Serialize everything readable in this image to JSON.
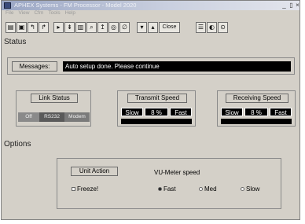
{
  "window": {
    "title": "APHEX Systems - FM Processor - Model 2020"
  },
  "menu": [
    "File",
    "View",
    "Cfm",
    "Tools",
    "Help"
  ],
  "toolbar": {
    "icons": [
      "open-icon",
      "save-icon",
      "undo-icon",
      "redo-icon",
      "play-icon",
      "play-all-icon",
      "chart-icon",
      "zoom-icon",
      "cursor-icon",
      "target-icon",
      "link-icon",
      "down-arrow-icon",
      "up-arrow-icon",
      "settings-icon",
      "speaker-icon",
      "power-icon"
    ],
    "close_label": "Close"
  },
  "status": {
    "heading": "Status",
    "message_label": "Messages:",
    "message_value": "Auto setup done. Please continue"
  },
  "link_status": {
    "label": "Link Status",
    "segments": [
      "Off",
      "RS232",
      "Modem"
    ]
  },
  "transmit_speed": {
    "label": "Transmit Speed",
    "slow": "Slow",
    "value": "8 %",
    "fast": "Fast"
  },
  "receiving_speed": {
    "label": "Receiving Speed",
    "slow": "Slow",
    "value": "8 %",
    "fast": "Fast"
  },
  "options": {
    "heading": "Options",
    "unit_action_label": "Unit Action",
    "freeze_label": "Freeze!",
    "vu_meter_label": "VU-Meter speed",
    "vu_options": [
      "Fast",
      "Med",
      "Slow"
    ],
    "vu_selected": "Fast"
  }
}
